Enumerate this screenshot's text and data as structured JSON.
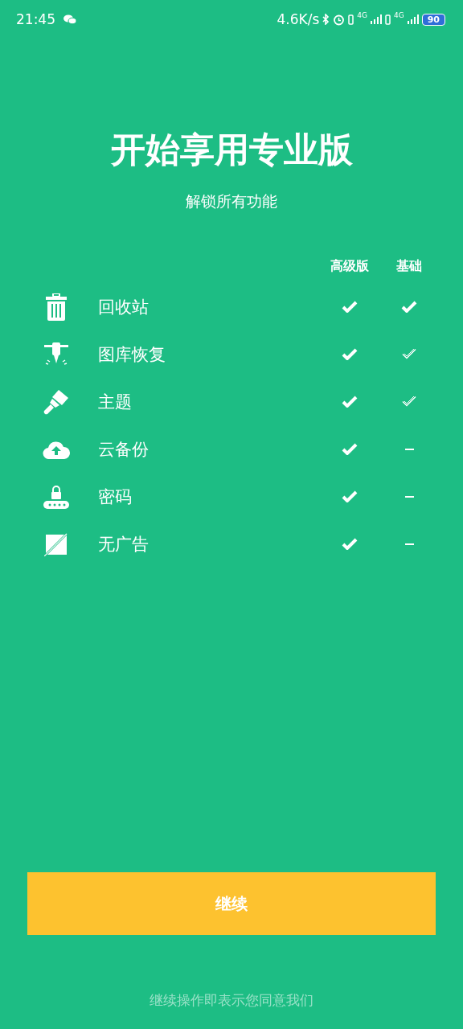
{
  "status_bar": {
    "time": "21:45",
    "speed": "4.6K/s",
    "network_1": "4G",
    "network_2": "4G",
    "battery": "90"
  },
  "title": "开始享用专业版",
  "subtitle": "解锁所有功能",
  "columns": [
    "高级版",
    "基础"
  ],
  "features": [
    {
      "label": "回收站",
      "cells": [
        {
          "kind": "full"
        },
        {
          "kind": "full"
        }
      ]
    },
    {
      "label": "图库恢复",
      "cells": [
        {
          "kind": "full"
        },
        {
          "kind": "partial"
        }
      ]
    },
    {
      "label": "主题",
      "cells": [
        {
          "kind": "full"
        },
        {
          "kind": "partial"
        }
      ]
    },
    {
      "label": "云备份",
      "cells": [
        {
          "kind": "full"
        },
        {
          "kind": "none"
        }
      ]
    },
    {
      "label": "密码",
      "cells": [
        {
          "kind": "full"
        },
        {
          "kind": "none"
        }
      ]
    },
    {
      "label": "无广告",
      "cells": [
        {
          "kind": "full"
        },
        {
          "kind": "none"
        }
      ]
    }
  ],
  "button": "继续",
  "footer": "继续操作即表示您同意我们"
}
